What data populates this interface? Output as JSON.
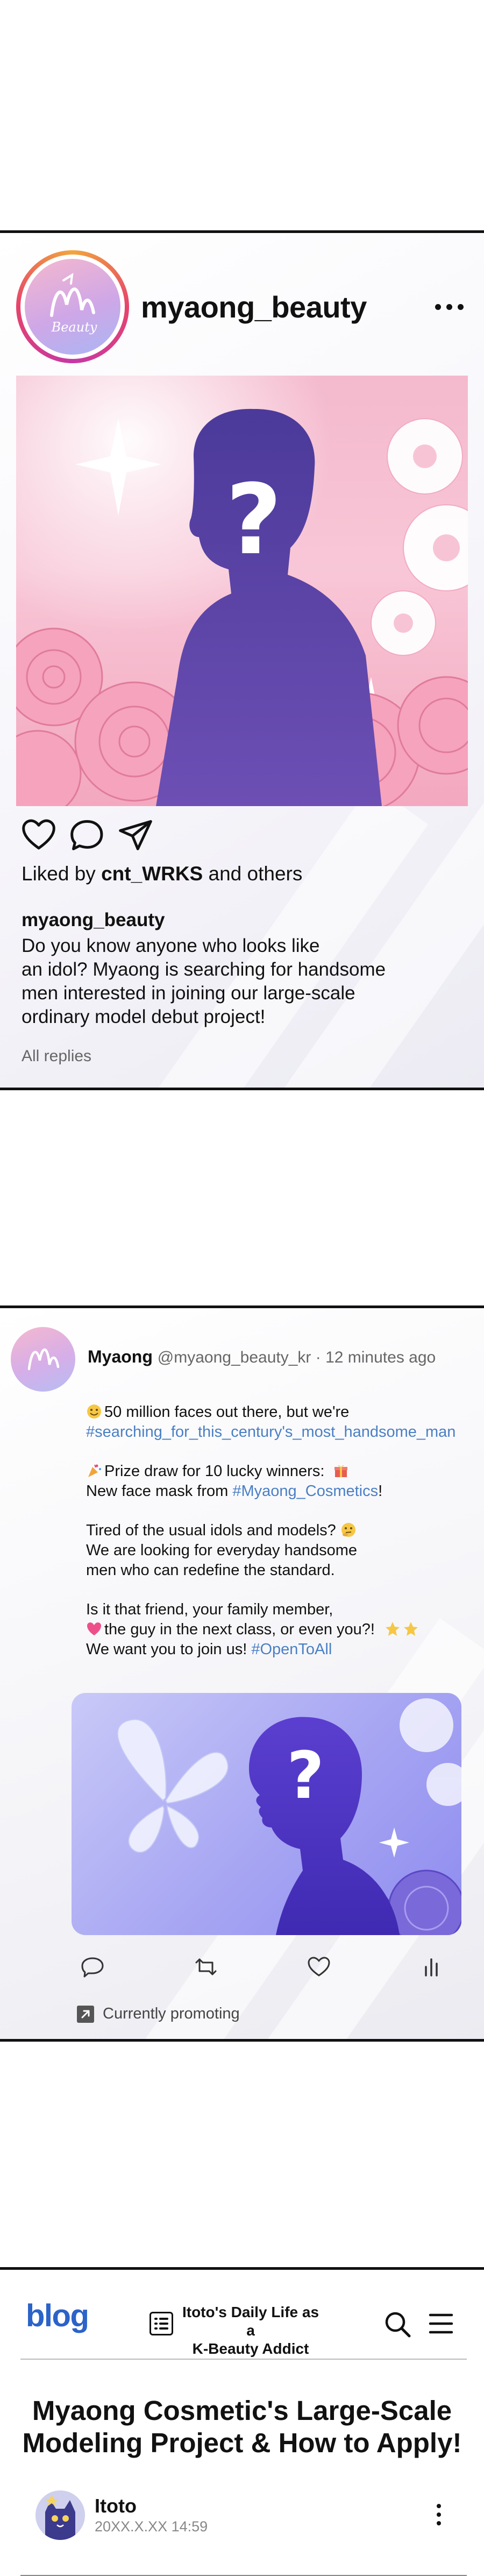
{
  "instagram": {
    "username": "myaong_beauty",
    "avatar_text": "Beauty",
    "image_glyph": "?",
    "liked_prefix": "Liked by ",
    "liked_user": "cnt_WRKS",
    "liked_suffix": " and others",
    "caption_user": "myaong_beauty",
    "caption_lines": [
      "Do you know anyone who looks like",
      "an idol? Myaong is searching for handsome",
      "men interested in joining our large-scale",
      "ordinary model debut project!"
    ],
    "replies_link": "All replies",
    "icons": [
      "heart-icon",
      "comment-icon",
      "share-icon",
      "more-icon"
    ]
  },
  "twitter": {
    "name": "Myaong",
    "handle": "@myaong_beauty_kr",
    "time": " · 12 minutes ago",
    "body": {
      "p1_line1": "50 million faces out there, but we're",
      "p1_tag": "#searching_for_this_century's_most_handsome_man",
      "p2_line1": "Prize draw for 10 lucky winners:",
      "p2_line2_prefix": "New face mask from ",
      "p2_tag": "#Myaong_Cosmetics",
      "p2_line2_suffix": "!",
      "p3_line1": "Tired of the usual idols and models?",
      "p3_line2": "We are looking for everyday handsome",
      "p3_line3": "men who can redefine the standard.",
      "p4_line1": "Is it that friend, your family member,",
      "p4_line2": "the guy in the next class, or even you?!",
      "p4_line3_prefix": "We want you to join us! ",
      "p4_tag": "#OpenToAll"
    },
    "image_glyph": "?",
    "promo_text": "Currently promoting",
    "icons": [
      "reply-icon",
      "retweet-icon",
      "like-icon",
      "stats-icon"
    ],
    "colors": {
      "hashtag": "#4a7fc4"
    }
  },
  "blog": {
    "logo": "blog",
    "blog_name_line1": "Itoto's Daily Life as a",
    "blog_name_line2": "K-Beauty Addict",
    "post_title_line1": "Myaong Cosmetic's Large-Scale",
    "post_title_line2": "Modeling Project & How to Apply!",
    "author": "Itoto",
    "date": "20XX.X.XX 14:59",
    "colors": {
      "logo": "#2b63c8"
    }
  }
}
